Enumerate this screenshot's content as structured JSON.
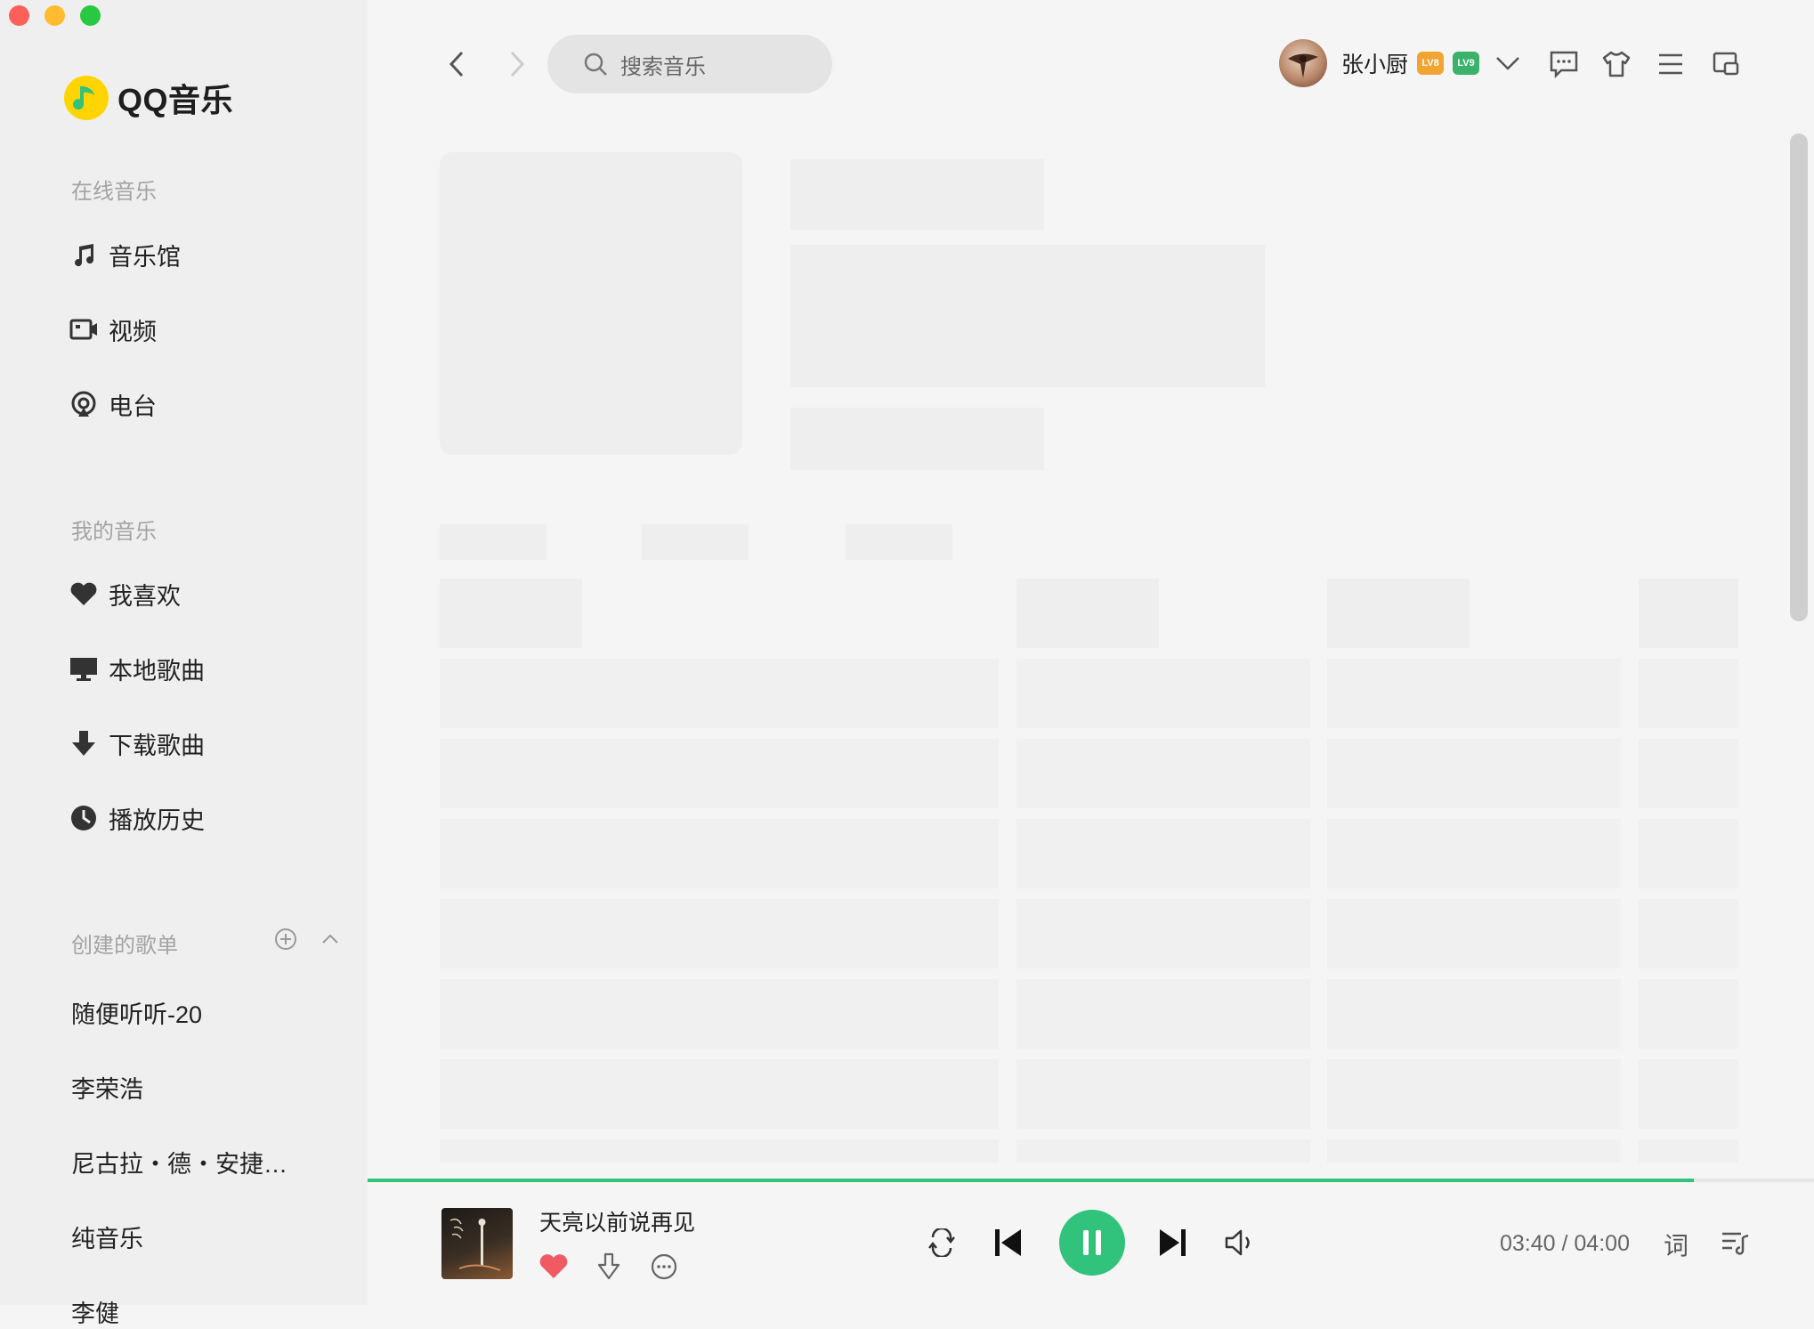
{
  "app": {
    "name": "QQ音乐",
    "accent_color": "#31c27c",
    "logo_color": "#ffd400"
  },
  "window": {
    "traffic_lights": [
      "close",
      "minimize",
      "maximize"
    ]
  },
  "sidebar": {
    "online_section": {
      "title": "在线音乐",
      "items": [
        {
          "label": "音乐馆",
          "icon": "music-note-icon"
        },
        {
          "label": "视频",
          "icon": "video-camera-icon"
        },
        {
          "label": "电台",
          "icon": "radio-icon"
        }
      ]
    },
    "my_section": {
      "title": "我的音乐",
      "items": [
        {
          "label": "我喜欢",
          "icon": "heart-icon"
        },
        {
          "label": "本地歌曲",
          "icon": "monitor-icon"
        },
        {
          "label": "下载歌曲",
          "icon": "download-arrow-icon"
        },
        {
          "label": "播放历史",
          "icon": "clock-icon"
        }
      ]
    },
    "playlists_section": {
      "title": "创建的歌单",
      "items": [
        {
          "label": "随便听听-20"
        },
        {
          "label": "李荣浩"
        },
        {
          "label": "尼古拉・德・安捷…"
        },
        {
          "label": "纯音乐"
        },
        {
          "label": "李健"
        }
      ]
    }
  },
  "topbar": {
    "search_placeholder": "搜索音乐",
    "user": {
      "name": "张小厨",
      "badge_1_text": "LV8",
      "badge_2_text": "LV9"
    }
  },
  "player": {
    "song_title": "天亮以前说再见",
    "current_time": "03:40",
    "separator": " / ",
    "total_time": "04:00",
    "progress": 0.917,
    "lyrics_label": "词",
    "liked": true,
    "state": "playing"
  }
}
